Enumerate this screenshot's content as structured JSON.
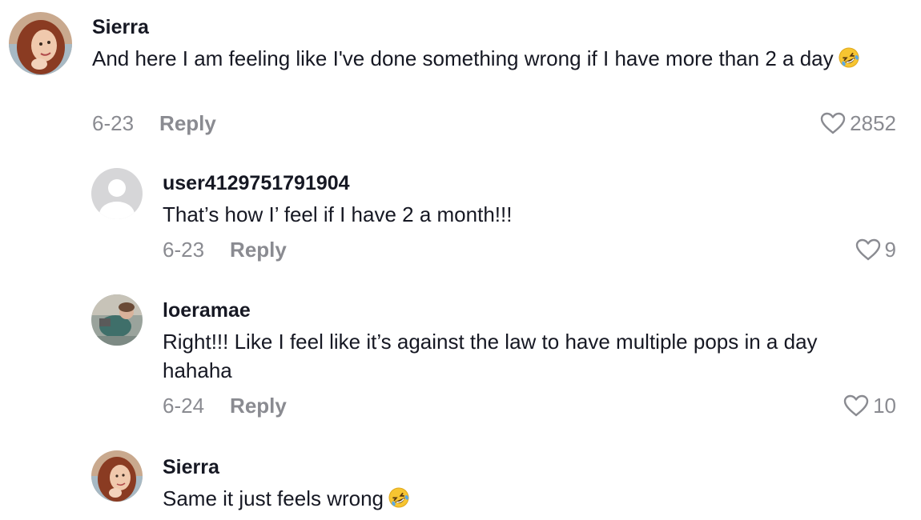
{
  "comments": [
    {
      "username": "Sierra",
      "text": "And here I am feeling like I've done something wrong if I have more than 2 a day",
      "emoji": "rolling-on-floor-laughing",
      "date": "6-23",
      "reply_label": "Reply",
      "likes": "2852"
    },
    {
      "username": "user4129751791904",
      "text": "That’s how I’ feel if I have 2 a month!!!",
      "date": "6-23",
      "reply_label": "Reply",
      "likes": "9"
    },
    {
      "username": "loeramae",
      "text": "Right!!! Like I feel like it’s against the law to have multiple pops in a day hahaha",
      "date": "6-24",
      "reply_label": "Reply",
      "likes": "10"
    },
    {
      "username": "Sierra",
      "text": "Same it just feels wrong",
      "emoji": "rolling-on-floor-laughing"
    }
  ],
  "colors": {
    "primary_text": "#161823",
    "secondary_text": "#8a8b91",
    "default_avatar_bg": "#d6d6d8",
    "heart_outline": "#8a8b91"
  },
  "icons": {
    "like": "heart-outline-icon",
    "emoji": "rolling-on-floor-laughing-emoji"
  }
}
